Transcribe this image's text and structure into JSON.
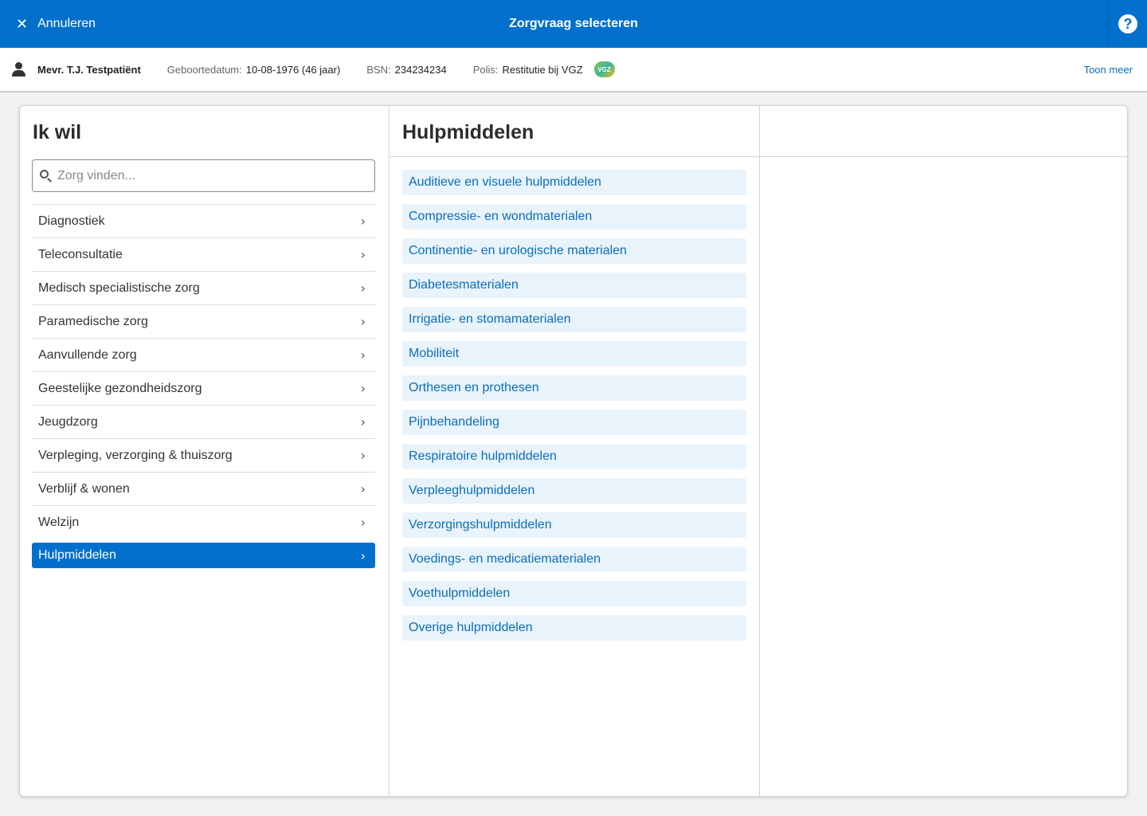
{
  "topbar": {
    "cancel_label": "Annuleren",
    "title": "Zorgvraag selecteren",
    "help_symbol": "?"
  },
  "patient": {
    "name": "Mevr. T.J. Testpatiënt",
    "dob_label": "Geboortedatum:",
    "dob_value": "10-08-1976 (46 jaar)",
    "bsn_label": "BSN:",
    "bsn_value": "234234234",
    "polis_label": "Polis:",
    "polis_value": "Restitutie bij VGZ",
    "insurer_logo_text": "VGZ",
    "show_more": "Toon meer"
  },
  "left": {
    "heading": "Ik wil",
    "search_placeholder": "Zorg vinden...",
    "items": [
      "Diagnostiek",
      "Teleconsultatie",
      "Medisch specialistische zorg",
      "Paramedische zorg",
      "Aanvullende zorg",
      "Geestelijke gezondheidszorg",
      "Jeugdzorg",
      "Verpleging, verzorging & thuiszorg",
      "Verblijf & wonen",
      "Welzijn",
      "Hulpmiddelen"
    ],
    "selected": "Hulpmiddelen"
  },
  "middle": {
    "heading": "Hulpmiddelen",
    "items": [
      "Auditieve en visuele hulpmiddelen",
      "Compressie- en wondmaterialen",
      "Continentie- en urologische materialen",
      "Diabetesmaterialen",
      "Irrigatie- en stomamaterialen",
      "Mobiliteit",
      "Orthesen en prothesen",
      "Pijnbehandeling",
      "Respiratoire hulpmiddelen",
      "Verpleeghulpmiddelen",
      "Verzorgingshulpmiddelen",
      "Voedings- en medicatiematerialen",
      "Voethulpmiddelen",
      "Overige hulpmiddelen"
    ]
  },
  "colors": {
    "primary": "#0070cc",
    "link": "#0a6fb5",
    "item_bg": "#e9f3fc"
  }
}
